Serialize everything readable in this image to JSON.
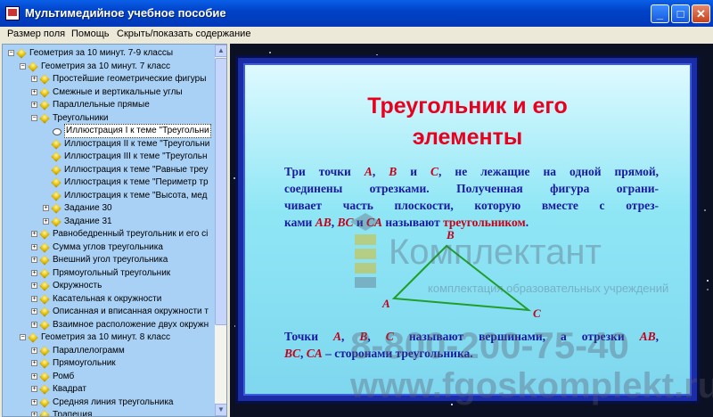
{
  "window": {
    "title": "Мультимедийное учебное пособие"
  },
  "menu": [
    "Размер поля",
    "Помощь",
    "Скрыть/показать содержание"
  ],
  "tree": [
    {
      "label": "Геометрия за 10 минут. 7-9 классы",
      "level": 0,
      "expander": "-"
    },
    {
      "label": "Геометрия за 10 минут. 7 класс",
      "level": 1,
      "expander": "-"
    },
    {
      "label": "Простейшие геометрические фигуры",
      "level": 2,
      "expander": "+"
    },
    {
      "label": "Смежные и вертикальные углы",
      "level": 2,
      "expander": "+"
    },
    {
      "label": "Параллельные прямые",
      "level": 2,
      "expander": "+"
    },
    {
      "label": "Треугольники",
      "level": 2,
      "expander": "-"
    },
    {
      "label": "Иллюстрация I к теме \"Треугольни",
      "level": 3,
      "expander": "",
      "selected": true
    },
    {
      "label": "Иллюстрация II к теме \"Треугольни",
      "level": 3,
      "expander": ""
    },
    {
      "label": "Иллюстрация III к теме \"Треугольн",
      "level": 3,
      "expander": ""
    },
    {
      "label": "Иллюстрация к теме \"Равные треу",
      "level": 3,
      "expander": ""
    },
    {
      "label": "Иллюстрация к теме \"Периметр тр",
      "level": 3,
      "expander": ""
    },
    {
      "label": "Иллюстрация к теме \"Высота, мед",
      "level": 3,
      "expander": ""
    },
    {
      "label": "Задание 30",
      "level": 3,
      "expander": "+"
    },
    {
      "label": "Задание 31",
      "level": 3,
      "expander": "+"
    },
    {
      "label": "Равнобедренный треугольник и его сі",
      "level": 2,
      "expander": "+"
    },
    {
      "label": "Сумма углов треугольника",
      "level": 2,
      "expander": "+"
    },
    {
      "label": "Внешний угол треугольника",
      "level": 2,
      "expander": "+"
    },
    {
      "label": "Прямоугольный треугольник",
      "level": 2,
      "expander": "+"
    },
    {
      "label": "Окружность",
      "level": 2,
      "expander": "+"
    },
    {
      "label": "Касательная к окружности",
      "level": 2,
      "expander": "+"
    },
    {
      "label": "Описанная и вписанная окружности т",
      "level": 2,
      "expander": "+"
    },
    {
      "label": "Взаимное расположение двух окружн",
      "level": 2,
      "expander": "+"
    },
    {
      "label": "Геометрия за 10 минут. 8 класс",
      "level": 1,
      "expander": "-"
    },
    {
      "label": "Параллелограмм",
      "level": 2,
      "expander": "+"
    },
    {
      "label": "Прямоугольник",
      "level": 2,
      "expander": "+"
    },
    {
      "label": "Ромб",
      "level": 2,
      "expander": "+"
    },
    {
      "label": "Квадрат",
      "level": 2,
      "expander": "+"
    },
    {
      "label": "Средняя линия треугольника",
      "level": 2,
      "expander": "+"
    },
    {
      "label": "Трапеция",
      "level": 2,
      "expander": "+"
    }
  ],
  "slide": {
    "title_line1": "Треугольник и его",
    "title_line2": "элементы",
    "para1": [
      [
        [
          "Три точки ",
          ""
        ],
        [
          "A",
          "v"
        ],
        [
          ", ",
          ""
        ],
        [
          "B",
          "v"
        ],
        [
          " и ",
          ""
        ],
        [
          "C",
          "v"
        ],
        [
          ", не лежащие на одной прямой,",
          ""
        ]
      ],
      [
        [
          "соединены отрезками. Полученная фигура ограни-",
          ""
        ]
      ],
      [
        [
          "чивает часть плоскости, которую вместе с отрез-",
          ""
        ]
      ],
      [
        [
          "ками ",
          ""
        ],
        [
          "AB",
          "v"
        ],
        [
          ", ",
          ""
        ],
        [
          "BC",
          "v"
        ],
        [
          " и ",
          ""
        ],
        [
          "CA",
          "v"
        ],
        [
          " называют ",
          ""
        ],
        [
          "треугольником",
          "r"
        ],
        [
          ".",
          ""
        ]
      ]
    ],
    "para2": [
      [
        [
          "Точки ",
          ""
        ],
        [
          "A",
          "v"
        ],
        [
          ", ",
          ""
        ],
        [
          "B",
          "v"
        ],
        [
          ", ",
          ""
        ],
        [
          "C",
          "v"
        ],
        [
          " называют вершинами, а отрезки ",
          ""
        ],
        [
          "AB",
          "v"
        ],
        [
          ",",
          ""
        ]
      ],
      [
        [
          "BC",
          "v"
        ],
        [
          ", ",
          ""
        ],
        [
          "CA",
          "v"
        ],
        [
          " – сторонами треугольника.",
          ""
        ]
      ]
    ],
    "vertex_a": "A",
    "vertex_b": "B",
    "vertex_c": "C",
    "triangle_color": "#1f9e2a"
  },
  "watermark": {
    "brand": "Комплектант",
    "subtitle": "комплектация образовательных учреждений",
    "phone": "8-800-200-75-40",
    "site": "www.fgoskomplekt.ru"
  }
}
